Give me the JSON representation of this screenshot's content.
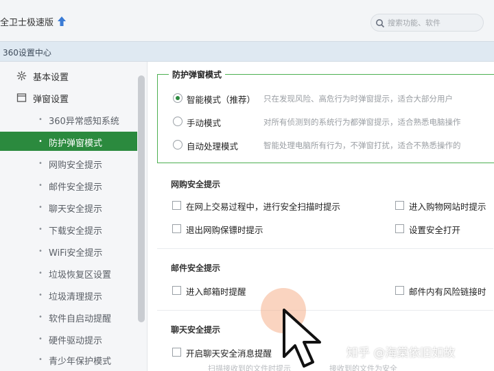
{
  "app": {
    "title": "全卫士极速版"
  },
  "search": {
    "placeholder": "搜索功能、软件"
  },
  "header": {
    "title": "360设置中心"
  },
  "sidebar": {
    "groups": [
      {
        "label": "基本设置",
        "icon": "gear-icon"
      },
      {
        "label": "弹窗设置",
        "icon": "window-icon"
      }
    ],
    "items": [
      {
        "label": "360异常感知系统",
        "active": false
      },
      {
        "label": "防护弹窗模式",
        "active": true
      },
      {
        "label": "网购安全提示",
        "active": false
      },
      {
        "label": "邮件安全提示",
        "active": false
      },
      {
        "label": "聊天安全提示",
        "active": false
      },
      {
        "label": "下载安全提示",
        "active": false
      },
      {
        "label": "WiFi安全提示",
        "active": false
      },
      {
        "label": "垃圾恢复区设置",
        "active": false
      },
      {
        "label": "垃圾清理提示",
        "active": false
      },
      {
        "label": "软件自启动提醒",
        "active": false
      },
      {
        "label": "硬件驱动提示",
        "active": false
      },
      {
        "label": "青少年保护模式",
        "active": false
      }
    ]
  },
  "mode_section": {
    "title": "防护弹窗模式",
    "options": [
      {
        "label": "智能模式（推荐）",
        "desc": "只在发现风险、高危行为时弹窗提示，适合大部分用户",
        "checked": true
      },
      {
        "label": "手动模式",
        "desc": "对所有侦测到的系统行为都弹窗提示，适合熟悉电脑操作",
        "checked": false
      },
      {
        "label": "自动处理模式",
        "desc": "智能处理电脑所有行为，不弹窗打扰，适合不熟悉操作的",
        "checked": false
      }
    ]
  },
  "shopping_section": {
    "title": "网购安全提示",
    "checks": [
      {
        "label": "在网上交易过程中，进行安全扫描时提示"
      },
      {
        "label": "进入购物网站时提示"
      },
      {
        "label": "退出网购保镖时提示"
      },
      {
        "label": "设置安全打开"
      }
    ]
  },
  "mail_section": {
    "title": "邮件安全提示",
    "checks": [
      {
        "label": "进入邮箱时提醒"
      },
      {
        "label": "邮件内有风险链接时"
      }
    ]
  },
  "chat_section": {
    "title": "聊天安全提示",
    "checks": [
      {
        "label": "开启聊天安全消息提醒"
      }
    ],
    "faded_left": "扫描接收到的文件时提示",
    "faded_right": "接收到的文件为安全"
  },
  "watermark": "知乎 @海棠依旧如故",
  "colors": {
    "accent": "#2b8a3e",
    "mode_border": "#4caf50",
    "header_bg": "#dfe9f2"
  }
}
